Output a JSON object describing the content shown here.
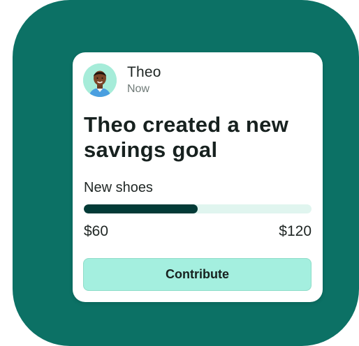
{
  "notification": {
    "user_name": "Theo",
    "timestamp": "Now",
    "headline": "Theo created a new savings goal",
    "avatar_icon": "person-avatar"
  },
  "goal": {
    "name": "New shoes",
    "current_amount": "$60",
    "target_amount": "$120",
    "progress_fraction": 0.5
  },
  "actions": {
    "contribute_label": "Contribute"
  },
  "colors": {
    "frame": "#0c7165",
    "progress_fill": "#033b37",
    "progress_track": "#e0f5ef",
    "button_bg": "#a4efdf"
  }
}
